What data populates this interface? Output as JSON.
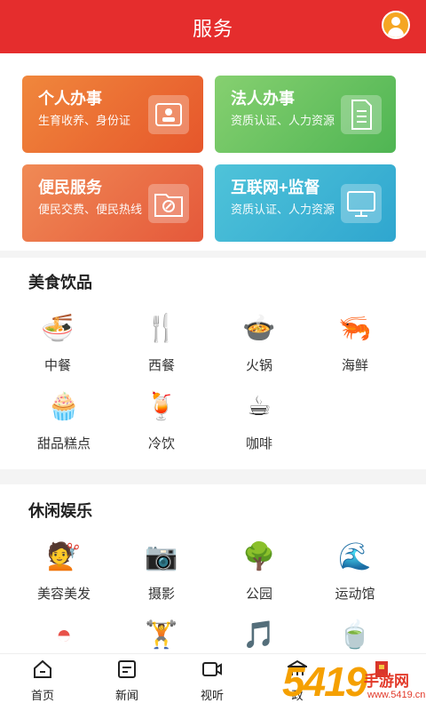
{
  "header": {
    "title": "服务",
    "avatar_icon": "user-avatar-icon"
  },
  "cards": [
    {
      "title": "个人办事",
      "subtitle": "生育收养、身份证",
      "icon": "id-card-icon"
    },
    {
      "title": "法人办事",
      "subtitle": "资质认证、人力资源",
      "icon": "document-icon"
    },
    {
      "title": "便民服务",
      "subtitle": "便民交费、便民热线",
      "icon": "compass-folder-icon"
    },
    {
      "title": "互联网+监督",
      "subtitle": "资质认证、人力资源",
      "icon": "monitor-icon"
    }
  ],
  "food": {
    "title": "美食饮品",
    "items": [
      {
        "label": "中餐",
        "icon": "noodle-bowl-icon",
        "glyph": "🍜"
      },
      {
        "label": "西餐",
        "icon": "fork-knife-icon",
        "glyph": "🍴"
      },
      {
        "label": "火锅",
        "icon": "hotpot-icon",
        "glyph": "🍲"
      },
      {
        "label": "海鲜",
        "icon": "shrimp-icon",
        "glyph": "🦐"
      },
      {
        "label": "甜品糕点",
        "icon": "cake-icon",
        "glyph": "🧁"
      },
      {
        "label": "冷饮",
        "icon": "cold-drink-icon",
        "glyph": "🍹"
      },
      {
        "label": "咖啡",
        "icon": "coffee-icon",
        "glyph": "☕"
      }
    ]
  },
  "leisure": {
    "title": "休闲娱乐",
    "items": [
      {
        "label": "美容美发",
        "icon": "beauty-icon",
        "glyph": "💇"
      },
      {
        "label": "摄影",
        "icon": "camera-icon",
        "glyph": "📷"
      },
      {
        "label": "公园",
        "icon": "tree-icon",
        "glyph": "🌳"
      },
      {
        "label": "运动馆",
        "icon": "wave-icon",
        "glyph": "🌊"
      }
    ],
    "partial_icons": [
      {
        "icon": "partial-red-dome-icon",
        "glyph": "◓"
      },
      {
        "icon": "dumbbell-icon",
        "glyph": "🏋"
      },
      {
        "icon": "music-note-icon",
        "glyph": "🎵"
      },
      {
        "icon": "tea-cup-icon",
        "glyph": "🍵"
      }
    ]
  },
  "tabbar": {
    "tabs": [
      {
        "label": "首页",
        "icon": "home-icon"
      },
      {
        "label": "新闻",
        "icon": "news-icon"
      },
      {
        "label": "视听",
        "icon": "video-icon"
      },
      {
        "label": "政",
        "icon": "gov-icon"
      },
      {
        "label": "",
        "icon": "party-icon"
      }
    ]
  },
  "watermark": {
    "number": "5419",
    "text": "手游网",
    "url": "www.5419.cn"
  },
  "colors": {
    "header": "#e52d2d",
    "accent_orange": "#f5a623"
  }
}
